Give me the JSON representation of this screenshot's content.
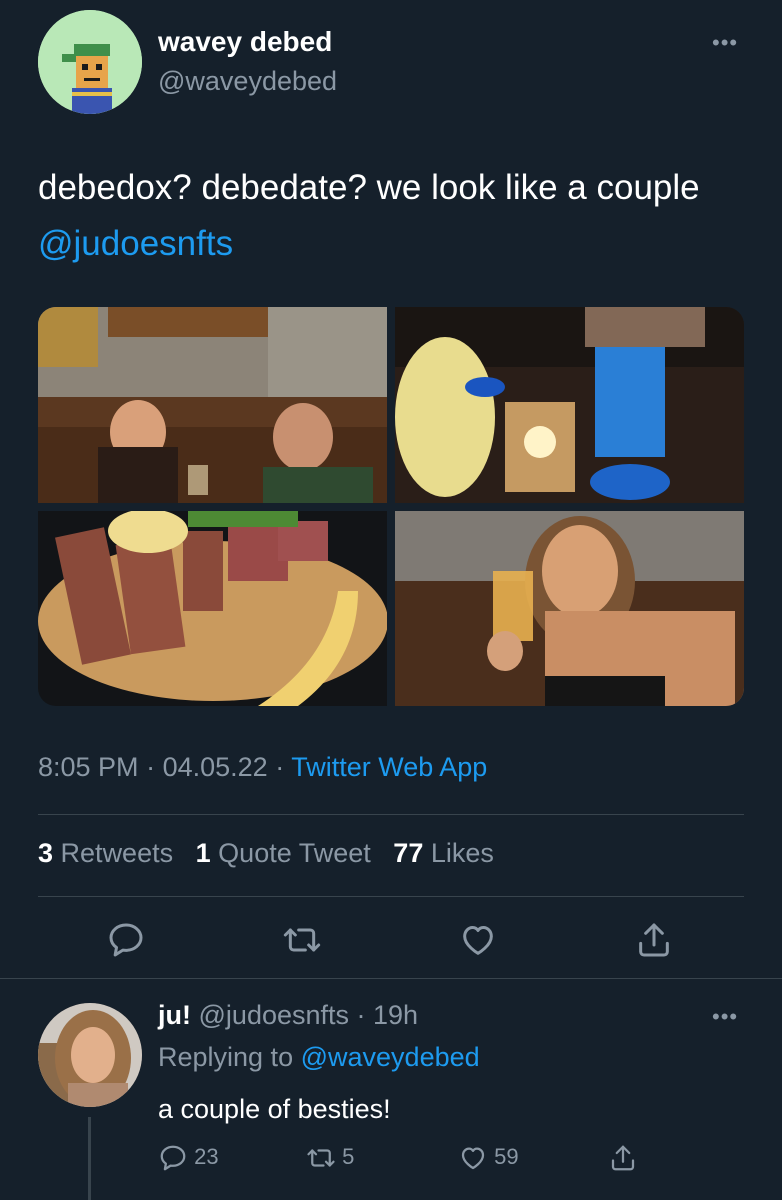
{
  "tweet": {
    "display_name": "wavey debed",
    "handle": "@waveydebed",
    "text_prefix": "debedox? debedate? we look like a couple ",
    "mention": "@judoesnfts",
    "time": "8:05 PM",
    "date": "04.05.22",
    "source": "Twitter Web App",
    "separator": "·",
    "retweets_count": "3",
    "retweets_label": "Retweets",
    "quotes_count": "1",
    "quotes_label": "Quote Tweet",
    "likes_count": "77",
    "likes_label": "Likes",
    "more": "•••"
  },
  "reply": {
    "display_name": "ju!",
    "handle": "@judoesnfts",
    "age": "19h",
    "replying_to_label": "Replying to",
    "replying_to_handle": "@waveydebed",
    "text": "a couple of besties!",
    "reply_count": "23",
    "retweet_count": "5",
    "like_count": "59",
    "more": "•••"
  },
  "icons": {
    "reply": "reply-icon",
    "retweet": "retweet-icon",
    "like": "heart-icon",
    "share": "share-icon"
  },
  "colors": {
    "background": "#15202b",
    "accent": "#1d9bf0",
    "muted": "#8b98a5",
    "divider": "#38444d"
  }
}
